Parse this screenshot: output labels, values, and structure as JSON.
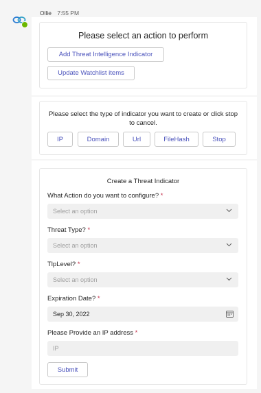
{
  "message": {
    "sender": "Ollie",
    "time": "7:55 PM"
  },
  "card1": {
    "title": "Please select an action to perform",
    "buttons": [
      "Add Threat Intelligence Indicator",
      "Update Watchlist items"
    ]
  },
  "card2": {
    "prompt": "Please select the type of indicator you want to create or click stop to cancel.",
    "buttons": [
      "IP",
      "Domain",
      "Url",
      "FileHash",
      "Stop"
    ]
  },
  "card3": {
    "title": "Create a Threat Indicator",
    "fields": [
      {
        "label": "What Action do you want to configure?",
        "required_mark": "*",
        "placeholder": "Select an option"
      },
      {
        "label": "Threat Type?",
        "required_mark": "*",
        "placeholder": "Select an option"
      },
      {
        "label": "TlpLevel?",
        "required_mark": "*",
        "placeholder": "Select an option"
      },
      {
        "label": "Expiration Date?",
        "required_mark": "*",
        "value": "Sep 30, 2022"
      },
      {
        "label": "Please Provide an IP address",
        "required_mark": "*",
        "placeholder": "IP"
      }
    ],
    "submit_label": "Submit"
  },
  "colors": {
    "accent": "#4b53bc",
    "required": "#c4314b",
    "status": "#6bb700"
  },
  "icons": {
    "avatar": "bot-avatar-icon",
    "dropdown": "chevron-down-icon",
    "date": "calendar-icon"
  }
}
